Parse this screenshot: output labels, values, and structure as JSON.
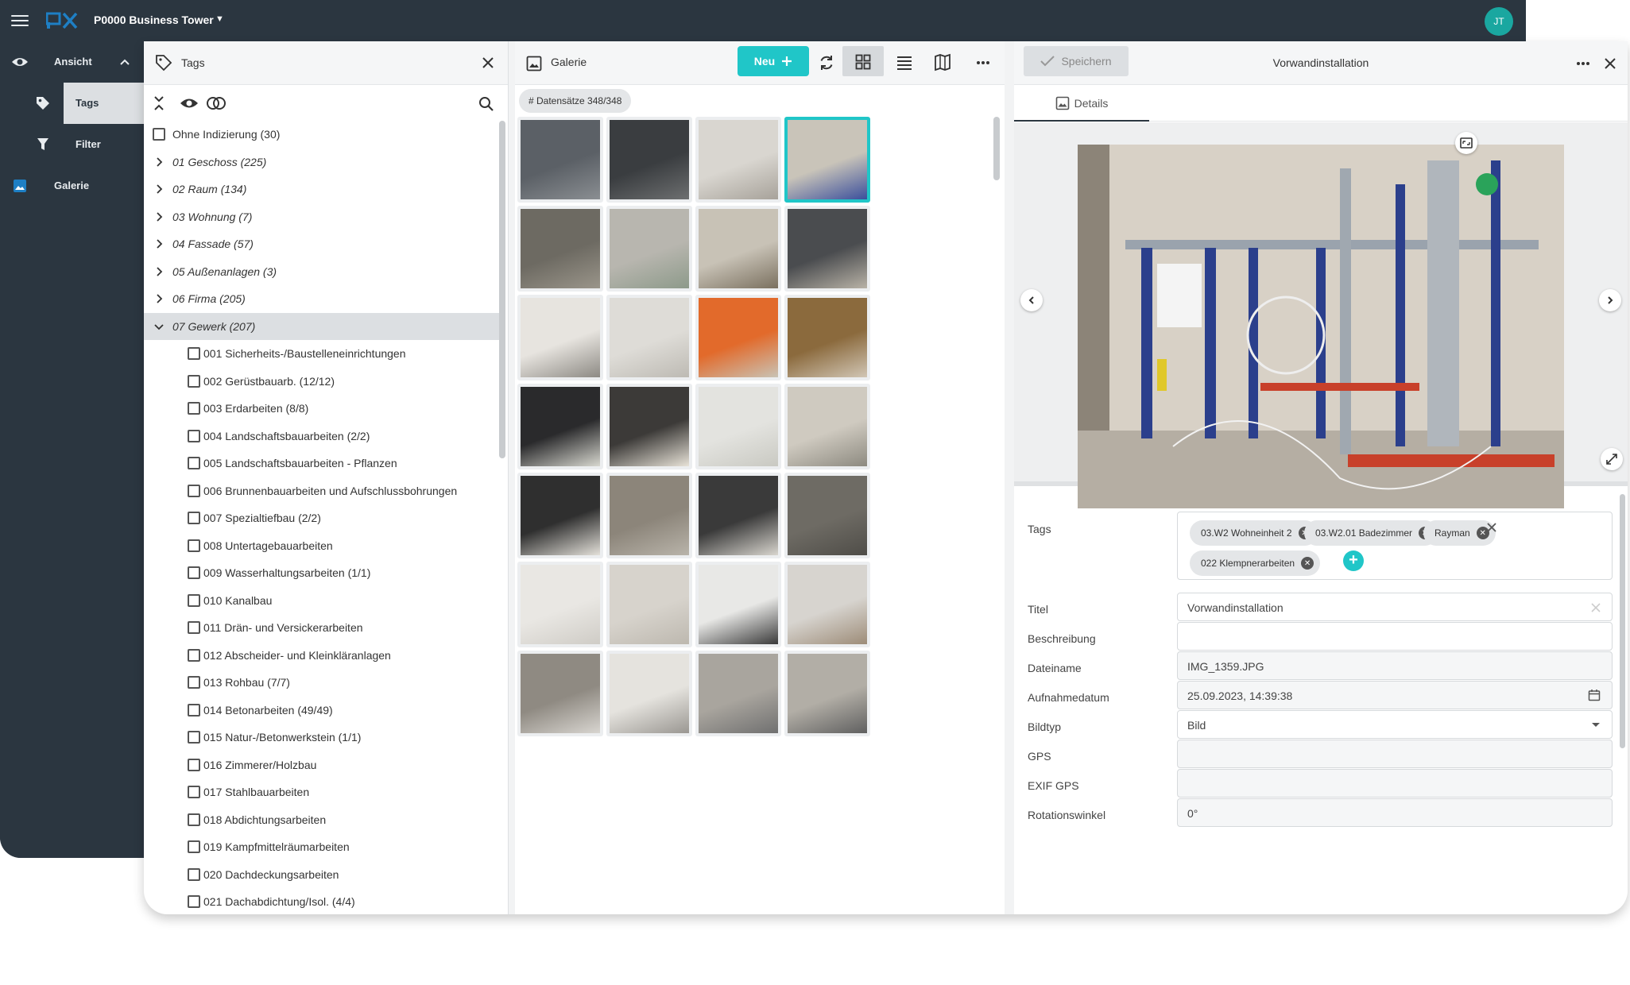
{
  "topbar": {
    "project_name": "P0000 Business Tower",
    "avatar_initials": "JT",
    "brand_color": "#1e7fc4",
    "accent_color": "#20c6c8"
  },
  "leftnav": {
    "items": [
      {
        "label": "Ansicht",
        "icon": "eye-icon"
      },
      {
        "label": "Tags",
        "icon": "tag-icon"
      },
      {
        "label": "Filter",
        "icon": "filter-icon"
      },
      {
        "label": "Galerie",
        "icon": "image-icon"
      }
    ]
  },
  "tags_panel": {
    "title": "Tags",
    "top_items": [
      {
        "label": "Ohne Indizierung (30)"
      },
      {
        "label": "01 Geschoss (225)"
      },
      {
        "label": "02 Raum (134)"
      },
      {
        "label": "03 Wohnung (7)"
      },
      {
        "label": "04 Fassade (57)"
      },
      {
        "label": "05 Außenanlagen (3)"
      },
      {
        "label": "06 Firma (205)"
      },
      {
        "label": "07 Gewerk (207)"
      }
    ],
    "children": [
      {
        "label": "001 Sicherheits-/Baustelleneinrichtungen"
      },
      {
        "label": "002 Gerüstbauarb. (12/12)"
      },
      {
        "label": "003 Erdarbeiten (8/8)"
      },
      {
        "label": "004 Landschaftsbauarbeiten (2/2)"
      },
      {
        "label": "005 Landschaftsbauarbeiten - Pflanzen"
      },
      {
        "label": "006 Brunnenbauarbeiten und Aufschlussbohrungen"
      },
      {
        "label": "007 Spezialtiefbau (2/2)"
      },
      {
        "label": "008 Untertagebauarbeiten"
      },
      {
        "label": "009 Wasserhaltungsarbeiten (1/1)"
      },
      {
        "label": "010 Kanalbau"
      },
      {
        "label": "011 Drän- und Versickerarbeiten"
      },
      {
        "label": "012 Abscheider- und Kleinkläranlagen"
      },
      {
        "label": "013 Rohbau (7/7)"
      },
      {
        "label": "014 Betonarbeiten (49/49)"
      },
      {
        "label": "015 Natur-/Betonwerkstein (1/1)"
      },
      {
        "label": "016 Zimmerer/Holzbau"
      },
      {
        "label": "017 Stahlbauarbeiten"
      },
      {
        "label": "018 Abdichtungsarbeiten"
      },
      {
        "label": "019 Kampfmittelräumarbeiten"
      },
      {
        "label": "020 Dachdeckungsarbeiten"
      },
      {
        "label": "021 Dachabdichtung/Isol. (4/4)"
      }
    ]
  },
  "galerie": {
    "title": "Galerie",
    "new_button": "Neu",
    "count_badge": "# Datensätze 348/348",
    "selected_index": 3
  },
  "detail": {
    "save_button": "Speichern",
    "title": "Vorwandinstallation",
    "tab_details": "Details",
    "labels": {
      "tags": "Tags",
      "titel": "Titel",
      "beschreibung": "Beschreibung",
      "dateiname": "Dateiname",
      "aufnahmedatum": "Aufnahmedatum",
      "bildtyp": "Bildtyp",
      "gps": "GPS",
      "exif_gps": "EXIF GPS",
      "rotationswinkel": "Rotationswinkel"
    },
    "tags": [
      "03.W2 Wohneinheit 2",
      "03.W2.01 Badezimmer",
      "Rayman",
      "022 Klempnerarbeiten"
    ],
    "values": {
      "titel": "Vorwandinstallation",
      "beschreibung": "",
      "dateiname": "IMG_1359.JPG",
      "aufnahmedatum": "25.09.2023, 14:39:38",
      "bildtyp": "Bild",
      "gps": "",
      "exif_gps": "",
      "rotationswinkel": "0°"
    }
  }
}
